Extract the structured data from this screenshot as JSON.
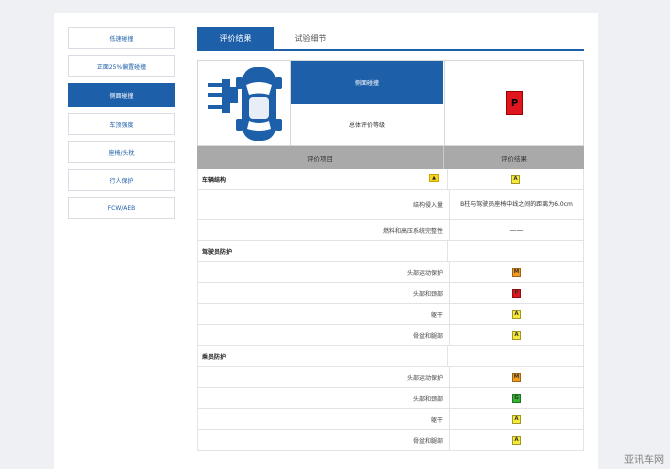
{
  "sidebar": {
    "items": [
      {
        "label": "低速碰撞",
        "active": false
      },
      {
        "label": "正面25%偏置碰撞",
        "active": false
      },
      {
        "label": "侧面碰撞",
        "active": true
      },
      {
        "label": "车顶强度",
        "active": false
      },
      {
        "label": "座椅/头枕",
        "active": false
      },
      {
        "label": "行人保护",
        "active": false
      },
      {
        "label": "FCW/AEB",
        "active": false
      }
    ]
  },
  "tabs": [
    {
      "label": "评价结果",
      "active": true
    },
    {
      "label": "试验细节",
      "active": false
    }
  ],
  "result": {
    "title": "侧面碰撞",
    "overall_label": "总体评价等级",
    "overall_rating": "P",
    "header_item": "评价项目",
    "header_result": "评价结果"
  },
  "colors": {
    "primary": "#1d5fa8",
    "rating_A": "#f6e93a",
    "rating_M": "#f29b21",
    "rating_P": "#e0161e",
    "rating_G": "#33b233"
  },
  "rows": [
    {
      "type": "section",
      "label": "车辆结构",
      "rating": "A",
      "has_arrow": true
    },
    {
      "type": "item",
      "label": "结构侵入量",
      "text": "B柱与驾驶员座椅中线之间的距离为6.0cm"
    },
    {
      "type": "item",
      "label": "燃料和高压系统完整性",
      "text": "——"
    },
    {
      "type": "section",
      "label": "驾驶员防护"
    },
    {
      "type": "item",
      "label": "头部运动保护",
      "rating": "M"
    },
    {
      "type": "item",
      "label": "头部和颈部",
      "rating": "P"
    },
    {
      "type": "item",
      "label": "躯干",
      "rating": "A"
    },
    {
      "type": "item",
      "label": "骨盆和腿部",
      "rating": "A"
    },
    {
      "type": "section",
      "label": "乘员防护"
    },
    {
      "type": "item",
      "label": "头部运动保护",
      "rating": "M"
    },
    {
      "type": "item",
      "label": "头部和颈部",
      "rating": "G"
    },
    {
      "type": "item",
      "label": "躯干",
      "rating": "A"
    },
    {
      "type": "item",
      "label": "骨盆和腿部",
      "rating": "A"
    }
  ],
  "watermark": "亚讯车网"
}
